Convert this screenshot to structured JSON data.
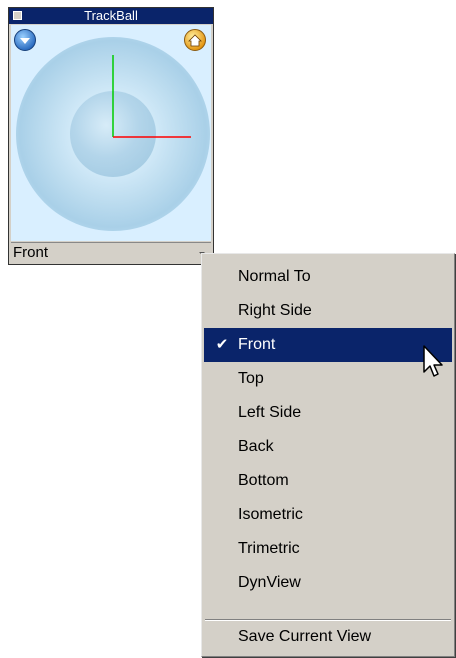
{
  "trackball": {
    "title": "TrackBall",
    "current_view": "Front",
    "colors": {
      "titlebar": "#0a246a",
      "view_background": "#d9efff",
      "axis_x": "#ff0000",
      "axis_y": "#00cc00"
    },
    "icons": {
      "left": "dropdown-circle-icon",
      "right": "home-view-icon"
    }
  },
  "view_menu": {
    "items": [
      {
        "label": "Normal To"
      },
      {
        "label": "Right Side"
      },
      {
        "label": "Front",
        "selected": true,
        "checked": true
      },
      {
        "label": "Top"
      },
      {
        "label": "Left Side"
      },
      {
        "label": "Back"
      },
      {
        "label": "Bottom"
      },
      {
        "label": "Isometric"
      },
      {
        "label": "Trimetric"
      },
      {
        "label": "DynView"
      }
    ],
    "footer_item": {
      "label": "Save Current View"
    },
    "check_glyph": "✔",
    "selection_color": "#0a246a"
  }
}
